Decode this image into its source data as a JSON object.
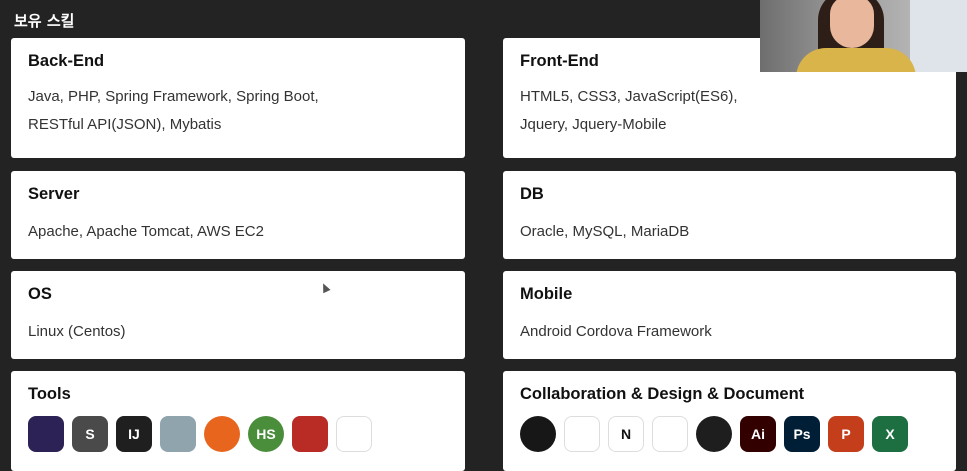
{
  "section_title": "보유 스킬",
  "cards": {
    "backend": {
      "title": "Back-End",
      "lines": [
        "Java, PHP, Spring Framework, Spring Boot,",
        "RESTful API(JSON), Mybatis"
      ]
    },
    "frontend": {
      "title": "Front-End",
      "lines": [
        "HTML5, CSS3, JavaScript(ES6),",
        "Jquery, Jquery-Mobile"
      ]
    },
    "server": {
      "title": "Server",
      "lines": [
        "Apache, Apache Tomcat, AWS EC2"
      ]
    },
    "db": {
      "title": "DB",
      "lines": [
        "Oracle, MySQL, MariaDB"
      ]
    },
    "os": {
      "title": "OS",
      "lines": [
        "Linux (Centos)"
      ]
    },
    "mobile": {
      "title": "Mobile",
      "lines": [
        "Android Cordova Framework"
      ]
    },
    "tools": {
      "title": "Tools"
    },
    "collab": {
      "title": "Collaboration & Design & Document"
    }
  },
  "icons": {
    "tools": [
      {
        "name": "eclipse-icon",
        "glyph": "",
        "bg": "#2c2255"
      },
      {
        "name": "sublime-text-icon",
        "glyph": "S",
        "bg": "#4a4a4a"
      },
      {
        "name": "intellij-icon",
        "glyph": "IJ",
        "bg": "#1f1f1f"
      },
      {
        "name": "dbeaver-icon",
        "glyph": "",
        "bg": "#8fa4ad"
      },
      {
        "name": "postman-icon",
        "glyph": "",
        "bg": "#e8651d"
      },
      {
        "name": "hs-icon",
        "glyph": "HS",
        "bg": "#4a8d3a"
      },
      {
        "name": "filezilla-icon",
        "glyph": "",
        "bg": "#b92b25"
      },
      {
        "name": "unity-icon",
        "glyph": "",
        "bg": "#ffffff"
      }
    ],
    "collab": [
      {
        "name": "github-icon",
        "glyph": "",
        "bg": "#181717"
      },
      {
        "name": "slack-icon",
        "glyph": "",
        "bg": "#ffffff"
      },
      {
        "name": "notion-icon",
        "glyph": "N",
        "bg": "#ffffff"
      },
      {
        "name": "google-drive-icon",
        "glyph": "",
        "bg": "#ffffff"
      },
      {
        "name": "figma-icon",
        "glyph": "",
        "bg": "#1e1e1e"
      },
      {
        "name": "illustrator-icon",
        "glyph": "Ai",
        "bg": "#330000"
      },
      {
        "name": "photoshop-icon",
        "glyph": "Ps",
        "bg": "#001e36"
      },
      {
        "name": "powerpoint-icon",
        "glyph": "P",
        "bg": "#c43e1c"
      },
      {
        "name": "excel-icon",
        "glyph": "X",
        "bg": "#1d6f42"
      }
    ]
  }
}
